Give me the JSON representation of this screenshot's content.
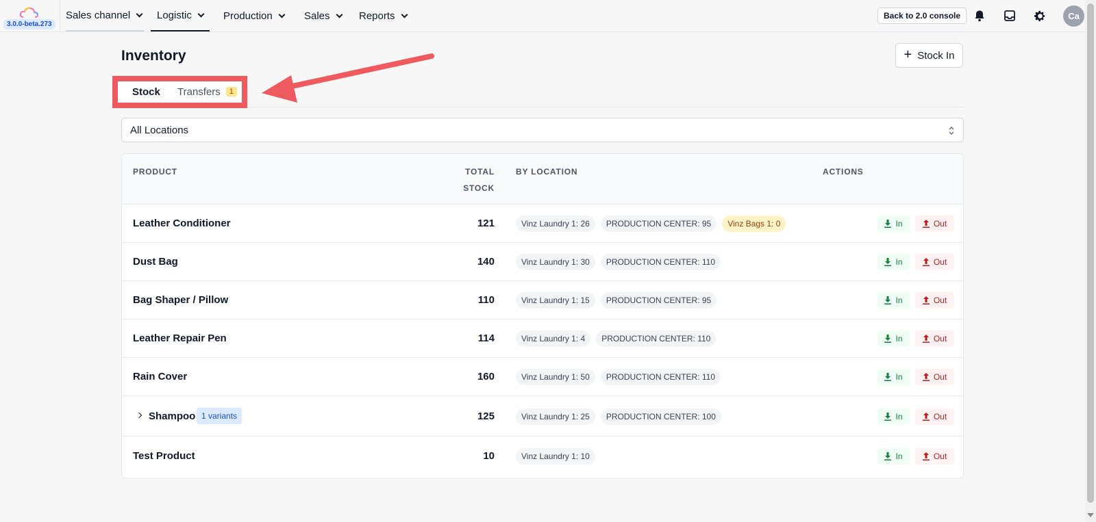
{
  "app": {
    "version": "3.0.0-beta.273",
    "nav": [
      {
        "label": "Sales channel"
      },
      {
        "label": "Logistic"
      },
      {
        "label": "Production"
      },
      {
        "label": "Sales"
      },
      {
        "label": "Reports"
      }
    ],
    "back_label": "Back to 2.0 console",
    "avatar_initials": "Ca",
    "icons": [
      "bell-icon",
      "inbox-icon",
      "gear-icon"
    ]
  },
  "page": {
    "title": "Inventory",
    "stock_in_label": "Stock In",
    "tabs": [
      {
        "label": "Stock",
        "badge": ""
      },
      {
        "label": "Transfers",
        "badge": "1"
      }
    ],
    "location_select": "All Locations"
  },
  "table": {
    "headers": {
      "product": "PRODUCT",
      "total_line1": "TOTAL",
      "total_line2": "STOCK",
      "by_location": "BY LOCATION",
      "actions": "ACTIONS"
    },
    "in_label": "In",
    "out_label": "Out",
    "rows": [
      {
        "name": "Leather Conditioner",
        "total": "121",
        "locations": [
          "Vinz Laundry 1: 26",
          "PRODUCTION CENTER: 95",
          "Vinz Bags 1: 0"
        ]
      },
      {
        "name": "Dust Bag",
        "total": "140",
        "locations": [
          "Vinz Laundry 1: 30",
          "PRODUCTION CENTER: 110"
        ]
      },
      {
        "name": "Bag Shaper / Pillow",
        "total": "110",
        "locations": [
          "Vinz Laundry 1: 15",
          "PRODUCTION CENTER: 95"
        ]
      },
      {
        "name": "Leather Repair Pen",
        "total": "114",
        "locations": [
          "Vinz Laundry 1: 4",
          "PRODUCTION CENTER: 110"
        ]
      },
      {
        "name": "Rain Cover",
        "total": "160",
        "locations": [
          "Vinz Laundry 1: 50",
          "PRODUCTION CENTER: 110"
        ]
      },
      {
        "name": "Shampoo",
        "variants": "1 variants",
        "total": "125",
        "locations": [
          "Vinz Laundry 1: 25",
          "PRODUCTION CENTER: 100"
        ]
      },
      {
        "name": "Test Product",
        "total": "10",
        "locations": [
          "Vinz Laundry 1: 10"
        ]
      }
    ]
  },
  "colors": {
    "annotation": "#ef5a5f",
    "in_green": "#15803d",
    "out_red": "#b91c1c"
  }
}
